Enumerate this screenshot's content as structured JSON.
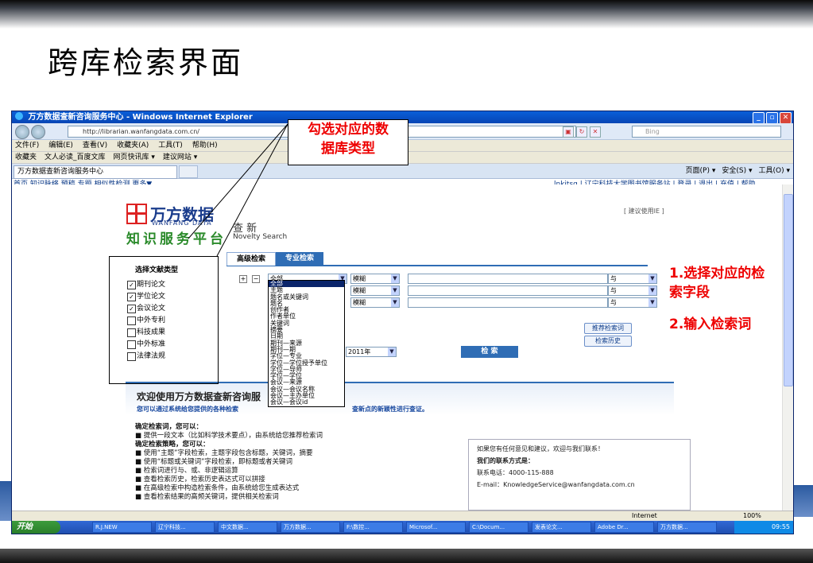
{
  "slide": {
    "title": "跨库检索界面"
  },
  "window": {
    "title": "万方数据查新咨询服务中心 - Windows Internet Explorer",
    "controls": [
      "_",
      "▫",
      "✕"
    ]
  },
  "browser": {
    "url": "http://librarian.wanfangdata.com.cn/",
    "search_placeholder": "Bing",
    "menu": [
      "文件(F)",
      "编辑(E)",
      "查看(V)",
      "收藏夹(A)",
      "工具(T)",
      "帮助(H)"
    ],
    "favorites": [
      "收藏夹",
      "文人必读_百度文库",
      "网页快讯库 ▾",
      "建议网站 ▾"
    ],
    "tab_title": "万方数据查新咨询服务中心",
    "commands": [
      "页面(P) ▾",
      "安全(S) ▾",
      "工具(O) ▾"
    ],
    "status_zone": "Internet",
    "zoom": "100%"
  },
  "site_nav": {
    "left": "首页  知识脉络  预稿  专题  相似性检测  更多▼",
    "right": "lnkjtsg | 辽宁科技大学图书馆服务站 | 登录 | 退出 | 充值 | 帮助"
  },
  "logo": {
    "name": "万方数据",
    "en": "WANFANG DATA",
    "subtitle": "知识服务平台",
    "product": "查 新",
    "product_en": "Novelty Search",
    "suggest": "[ 建议使用IE ]"
  },
  "doc_types": {
    "header": "选择文献类型",
    "items": [
      {
        "label": "期刊论文",
        "checked": true
      },
      {
        "label": "学位论文",
        "checked": true
      },
      {
        "label": "会议论文",
        "checked": true
      },
      {
        "label": "中外专利",
        "checked": false
      },
      {
        "label": "科技成果",
        "checked": false
      },
      {
        "label": "中外标准",
        "checked": false
      },
      {
        "label": "法律法规",
        "checked": false
      }
    ]
  },
  "search": {
    "tabs": [
      "高级检索",
      "专业检索"
    ],
    "field_default": "全部",
    "match_default": "模糊",
    "logic_default": "与",
    "year": "2011年",
    "search_button": "检 索",
    "recommend_button": "推荐检索词",
    "history_button": "检索历史"
  },
  "field_options": [
    "全部",
    "主题",
    "题名或关键词",
    "题名",
    "创作者",
    "作者单位",
    "关键词",
    "摘要",
    "日期",
    "期刊—来源",
    "期刊—期",
    "学位—专业",
    "学位—学位授予单位",
    "学位—导师",
    "学位—学位",
    "会议—来源",
    "会议—会议名称",
    "会议—主办单位",
    "会议—会议id"
  ],
  "welcome": {
    "title": "欢迎使用万方数据查新咨询服",
    "line1": "您可以通过系统给您提供的各种检索",
    "line2": "查新点的新颖性进行查证。"
  },
  "tips": {
    "h1": "确定检索词，您可以：",
    "a1": "■  提供一段文本（比如科学技术要点），由系统给您推荐检索词",
    "h2": "确定检索策略，您可以：",
    "items": [
      "■  使用“主题”字段检索，主题字段包含标题，关键词，摘要",
      "■  使用“标题或关键词”字段检索，即标题或者关键词",
      "■  检索词进行与、或、非逻辑运算",
      "■  查看检索历史，检索历史表达式可以拼接",
      "■  在高级检索中构造检索条件，由系统给您生成表达式",
      "■  查看检索结果的高频关键词，提供相关检索词"
    ]
  },
  "contact": {
    "line1": "如果您有任何意见和建议，欢迎与我们联系！",
    "line2": "我们的联系方式是：",
    "phone": "联系电话：4000-115-888",
    "email": "E-mail：KnowledgeService@wanfangdata.com.cn"
  },
  "taskbar": {
    "start": "开始",
    "tasks": [
      "R.J.NEW",
      "辽宁科技...",
      "中文数据...",
      "万方数据...",
      "F:\\数控...",
      "Microsof...",
      "C:\\Docum...",
      "发表论文...",
      "Adobe Dr...",
      "万方数据..."
    ],
    "clock": "09:55"
  },
  "annotations": {
    "callout": "勾选对应的数据库类型",
    "note1": "1.选择对应的检索字段",
    "note2": "2.输入检索词"
  },
  "colors": {
    "accent": "#2f6db5",
    "annotation": "#ee0000",
    "logo_red": "#dd2222",
    "logo_green": "#2a8a2a"
  }
}
